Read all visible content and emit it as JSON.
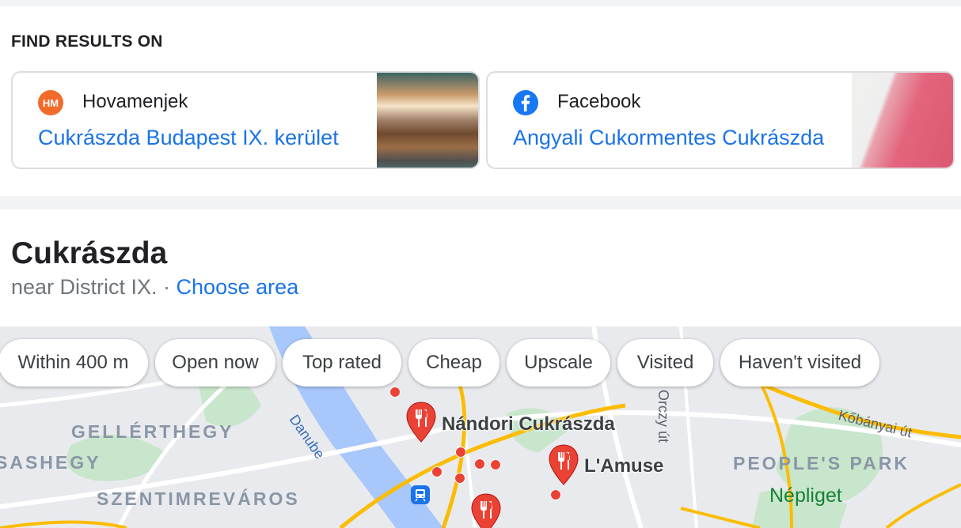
{
  "find_results": {
    "heading": "FIND RESULTS ON",
    "cards": [
      {
        "logo_text": "HM",
        "source": "Hovamenjek",
        "title": "Cukrászda Budapest IX. kerület"
      },
      {
        "source": "Facebook",
        "title": "Angyali Cukormentes Cukrászda"
      }
    ]
  },
  "local": {
    "title": "Cukrászda",
    "near_prefix": "near District IX. · ",
    "choose_area": "Choose area"
  },
  "filters": [
    "Within 400 m",
    "Open now",
    "Top rated",
    "Cheap",
    "Upscale",
    "Visited",
    "Haven't visited"
  ],
  "map": {
    "area_labels": [
      "GELLÉRTHEGY",
      "SASHEGY",
      "SZENTIMREVÁROS",
      "PEOPLE'S PARK"
    ],
    "river": "Danube",
    "streets": [
      "Orczy út",
      "Kőbányai út"
    ],
    "park": "Népliget",
    "places": [
      "Nándori Cukrászda",
      "L'Amuse"
    ],
    "pin_color": "#ea4335",
    "road_color": "#fbbc04"
  }
}
